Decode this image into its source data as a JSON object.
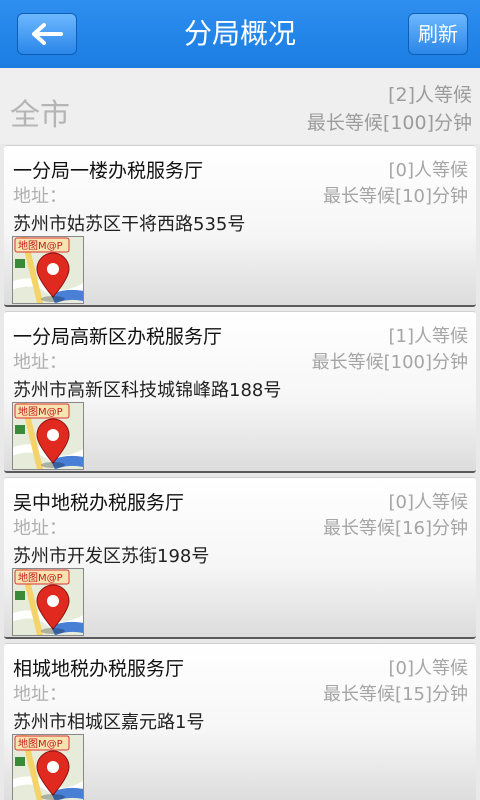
{
  "header": {
    "title": "分局概况",
    "refresh_label": "刷新"
  },
  "summary": {
    "city": "全市",
    "waiting": "[2]人等候",
    "max_wait": "最长等候[100]分钟"
  },
  "offices": [
    {
      "name": "一分局一楼办税服务厅",
      "waiting": "[0]人等候",
      "address_label": "地址：",
      "max_wait": "最长等候[10]分钟",
      "address": "苏州市姑苏区干将西路535号",
      "map_badge": "地图M@P"
    },
    {
      "name": "一分局高新区办税服务厅",
      "waiting": "[1]人等候",
      "address_label": "地址：",
      "max_wait": "最长等候[100]分钟",
      "address": "苏州市高新区科技城锦峰路188号",
      "map_badge": "地图M@P"
    },
    {
      "name": "吴中地税办税服务厅",
      "waiting": "[0]人等候",
      "address_label": "地址：",
      "max_wait": "最长等候[16]分钟",
      "address": "苏州市开发区苏街198号",
      "map_badge": "地图M@P"
    },
    {
      "name": "相城地税办税服务厅",
      "waiting": "[0]人等候",
      "address_label": "地址：",
      "max_wait": "最长等候[15]分钟",
      "address": "苏州市相城区嘉元路1号",
      "map_badge": "地图M@P"
    }
  ],
  "colors": {
    "title_bar": "#1b7ce2",
    "pin": "#e02a1f"
  }
}
